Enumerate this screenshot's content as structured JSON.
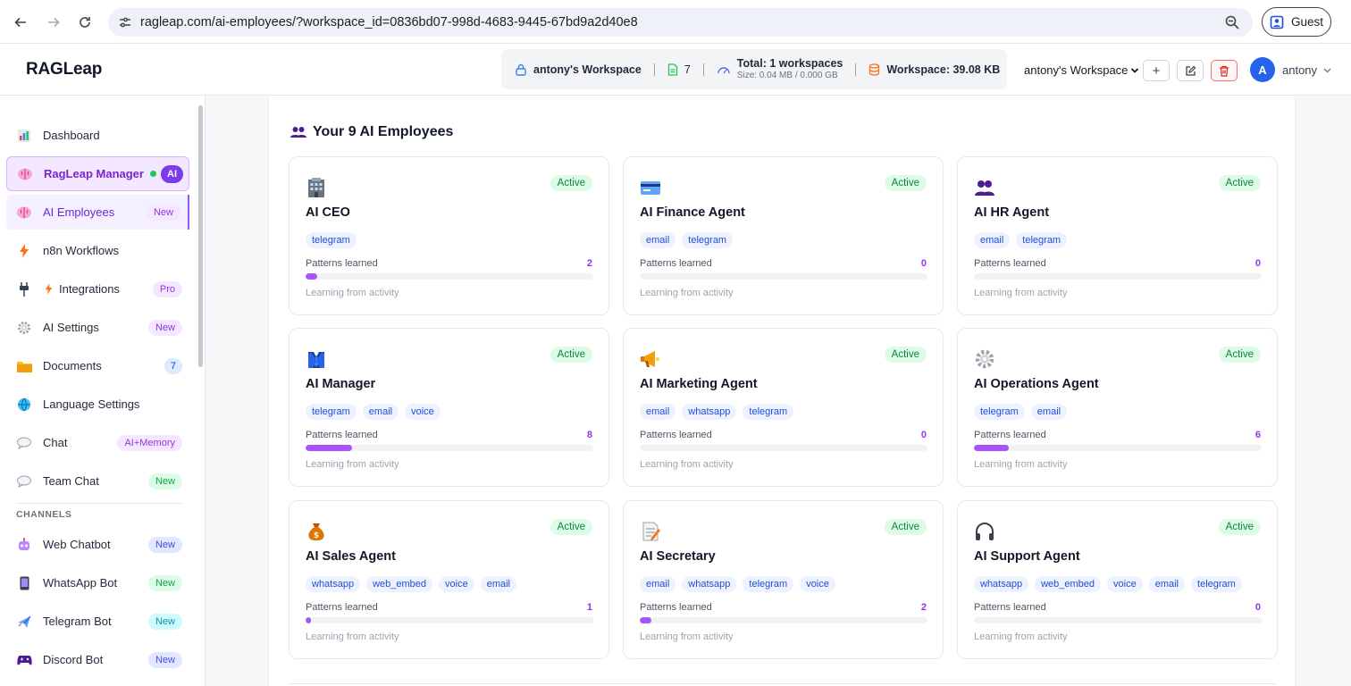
{
  "browser": {
    "url": "ragleap.com/ai-employees/?workspace_id=0836bd07-998d-4683-9445-67bd9a2d40e8",
    "profile_label": "Guest"
  },
  "header": {
    "logo": "RAGLeap",
    "workspace_name": "antony's Workspace",
    "doc_count": "7",
    "total_label": "Total: 1 workspaces",
    "size_label": "Size: 0.04 MB / 0.000 GB",
    "workspace_size": "Workspace: 39.08 KB",
    "workspace_select": "antony's Workspace",
    "add_btn": "+",
    "avatar_letter": "A",
    "user_name": "antony"
  },
  "sidebar": {
    "items": [
      {
        "label": "Dashboard",
        "icon": "chart-icon"
      },
      {
        "label": "RagLeap Manager",
        "badge": "AI",
        "icon": "brain-icon"
      },
      {
        "label": "AI Employees",
        "badge": "New",
        "icon": "brain-icon"
      },
      {
        "label": "n8n Workflows",
        "icon": "lightning-icon"
      },
      {
        "label": "Integrations",
        "badge": "Pro",
        "icon": "plug-icon"
      },
      {
        "label": "AI Settings",
        "badge": "New",
        "icon": "gear-icon"
      },
      {
        "label": "Documents",
        "badge": "7",
        "icon": "folder-icon"
      },
      {
        "label": "Language Settings",
        "icon": "globe-icon"
      },
      {
        "label": "Chat",
        "badge": "AI+Memory",
        "icon": "speech-bubble-icon"
      },
      {
        "label": "Team Chat",
        "badge": "New",
        "icon": "speech-bubble-icon"
      }
    ],
    "channels_header": "CHANNELS",
    "channels": [
      {
        "label": "Web Chatbot",
        "badge": "New",
        "icon": "robot-icon"
      },
      {
        "label": "WhatsApp Bot",
        "badge": "New",
        "icon": "phone-icon"
      },
      {
        "label": "Telegram Bot",
        "badge": "New",
        "icon": "airplane-icon"
      },
      {
        "label": "Discord Bot",
        "badge": "New",
        "icon": "gamepad-icon"
      }
    ]
  },
  "main": {
    "section_title": "Your 9 AI Employees",
    "patterns_label": "Patterns learned",
    "learning_label": "Learning from activity",
    "employees": [
      {
        "name": "AI CEO",
        "status": "Active",
        "tags": [
          "telegram"
        ],
        "patterns": "2",
        "progress_pct": 4,
        "icon": "building-icon"
      },
      {
        "name": "AI Finance Agent",
        "status": "Active",
        "tags": [
          "email",
          "telegram"
        ],
        "patterns": "0",
        "progress_pct": 0,
        "icon": "credit-card-icon"
      },
      {
        "name": "AI HR Agent",
        "status": "Active",
        "tags": [
          "email",
          "telegram"
        ],
        "patterns": "0",
        "progress_pct": 0,
        "icon": "people-icon"
      },
      {
        "name": "AI Manager",
        "status": "Active",
        "tags": [
          "telegram",
          "email",
          "voice"
        ],
        "patterns": "8",
        "progress_pct": 16,
        "icon": "suit-icon"
      },
      {
        "name": "AI Marketing Agent",
        "status": "Active",
        "tags": [
          "email",
          "whatsapp",
          "telegram"
        ],
        "patterns": "0",
        "progress_pct": 0,
        "icon": "megaphone-icon"
      },
      {
        "name": "AI Operations Agent",
        "status": "Active",
        "tags": [
          "telegram",
          "email"
        ],
        "patterns": "6",
        "progress_pct": 12,
        "icon": "gear-icon"
      },
      {
        "name": "AI Sales Agent",
        "status": "Active",
        "tags": [
          "whatsapp",
          "web_embed",
          "voice",
          "email"
        ],
        "patterns": "1",
        "progress_pct": 2,
        "icon": "money-bag-icon"
      },
      {
        "name": "AI Secretary",
        "status": "Active",
        "tags": [
          "email",
          "whatsapp",
          "telegram",
          "voice"
        ],
        "patterns": "2",
        "progress_pct": 4,
        "icon": "memo-icon"
      },
      {
        "name": "AI Support Agent",
        "status": "Active",
        "tags": [
          "whatsapp",
          "web_embed",
          "voice",
          "email",
          "telegram"
        ],
        "patterns": "0",
        "progress_pct": 0,
        "icon": "headphones-icon"
      }
    ]
  },
  "colors": {
    "accent": "#7c3aed",
    "active_green": "#15803d",
    "progress": "#a855f7"
  }
}
